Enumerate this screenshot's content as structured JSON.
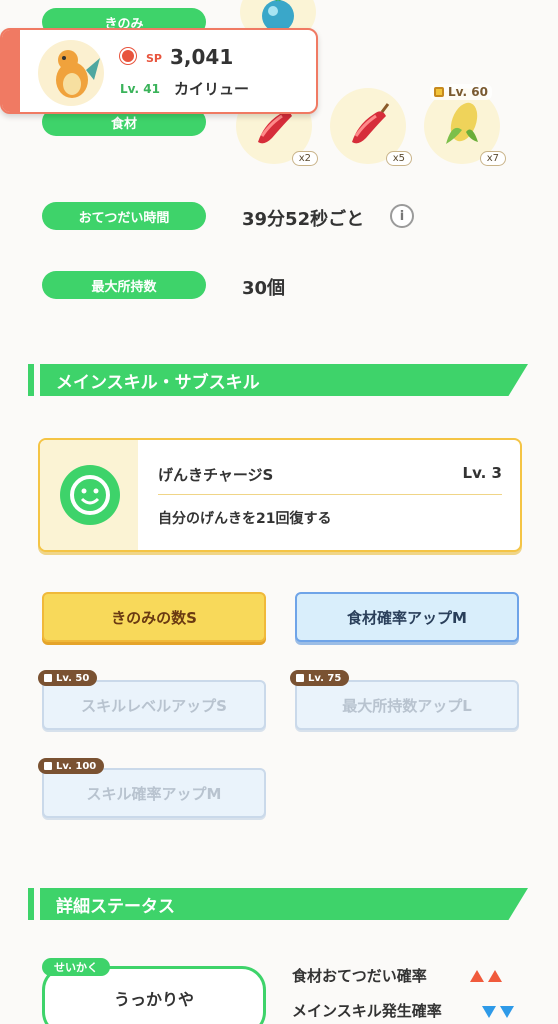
{
  "labels": {
    "berry": "きのみ",
    "ingredients": "食材",
    "help_time": "おてつだい時間",
    "max_carry": "最大所持数"
  },
  "values": {
    "help_time": "39分52秒ごと",
    "max_carry": "30個"
  },
  "ingredients": [
    {
      "count": "x2"
    },
    {
      "count": "x5"
    },
    {
      "count": "x7",
      "lock_level": "Lv. 60"
    }
  ],
  "pokemon_card": {
    "sp_label": "SP",
    "sp_value": "3,041",
    "level": "Lv. 41",
    "name": "カイリュー"
  },
  "sections": {
    "skills_title": "メインスキル・サブスキル",
    "details_title": "詳細ステータス"
  },
  "main_skill": {
    "name": "げんきチャージS",
    "level": "Lv. 3",
    "description": "自分のげんきを21回復する"
  },
  "sub_skills": [
    {
      "label": "きのみの数S",
      "style": "yellow"
    },
    {
      "label": "食材確率アップM",
      "style": "blue"
    },
    {
      "label": "スキルレベルアップS",
      "lock": "Lv. 50"
    },
    {
      "label": "最大所持数アップL",
      "lock": "Lv. 75"
    },
    {
      "label": "スキル確率アップM",
      "lock": "Lv. 100"
    }
  ],
  "details": {
    "nature_tag": "せいかく",
    "nature": "うっかりや",
    "effect1": "食材おてつだい確率",
    "effect2": "メインスキル発生確率"
  },
  "colors": {
    "accent_green": "#3ed36a",
    "up_arrow": "#f05a3c",
    "down_arrow": "#2e9ae8"
  }
}
